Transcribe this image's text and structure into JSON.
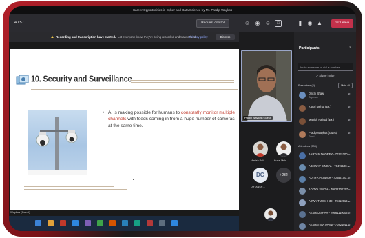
{
  "window": {
    "title": "Career Opportunities in Cyber and Data Science by Mr. Pradip Waykos"
  },
  "toolbar": {
    "timer": "40:57",
    "request_control": "Request control",
    "leave": "Leave"
  },
  "banner": {
    "bold": "Recording and transcription have started.",
    "rest": "Let everyone know they're being recorded and transcribed.",
    "link": "Privacy policy",
    "dismiss": "Dismiss"
  },
  "slide": {
    "title": "10. Security and Surveillance",
    "bullet_dot": "•",
    "bullet_pre": "AI is making possible for humans to ",
    "bullet_highlight": "constantly monitor multiple channels",
    "bullet_post": " with feeds coming in from a huge number of cameras at the same time."
  },
  "presenter_label": "Waykos (Guest)",
  "stage": {
    "main_video_name": "Pradip Waykos (Guest)",
    "tiles": [
      {
        "name": "Manish Pali..."
      },
      {
        "name": "Kunal Mehl..."
      },
      {
        "name": "DHYANSH ...",
        "initials": "DG"
      },
      {
        "more": "+232"
      }
    ]
  },
  "panel": {
    "title": "Participants",
    "close": "×",
    "invite_placeholder": "Invite someone or dial a number",
    "share_invite": "Share invite",
    "presenters_label": "Presenters (4)",
    "mute_all": "Mute all",
    "presenters": [
      {
        "name": "Dhiraj Shaw",
        "role": "Organizer"
      },
      {
        "name": "Kunal Mehta (Ex.)",
        "role": ""
      },
      {
        "name": "Manish Paliwal (Ex.)",
        "role": ""
      },
      {
        "name": "Pradip Waykos (Guest)",
        "role": "Guest"
      }
    ],
    "attendees_label": "Attendees (233)",
    "attendees": [
      {
        "name": "AARYAN DHOREY - 70321100..."
      },
      {
        "name": "ABHINAV SINGAL - 70472100..."
      },
      {
        "name": "ADITYA PATIDAR - 70552100..."
      },
      {
        "name": "ADITYA SINGH - 70822100257"
      },
      {
        "name": "ADWAIT JOSHI 39 - 70412019..."
      },
      {
        "name": "AKSHAJ SHAH - 70661119003"
      },
      {
        "name": "AKSHAT MATHANI - 70821011..."
      }
    ]
  },
  "colors": {
    "accent": "#c4314b",
    "frame": "#b2202a",
    "slide_highlight": "#c0392b",
    "link": "#8fa8ff"
  }
}
